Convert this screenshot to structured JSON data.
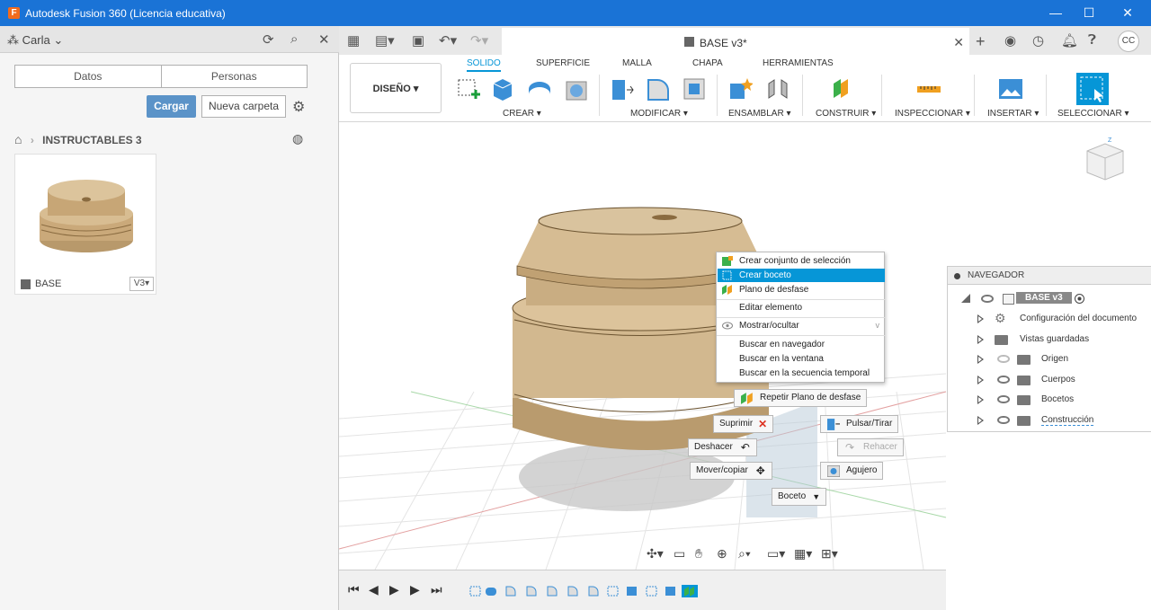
{
  "window": {
    "title": "Autodesk Fusion 360 (Licencia educativa)",
    "minimize": "—",
    "maximize": "☐",
    "close": "✕"
  },
  "left_panel": {
    "user": "Carla",
    "tabs": [
      "Datos",
      "Personas"
    ],
    "upload_label": "Cargar",
    "new_folder_label": "Nueva carpeta",
    "breadcrumb": "INSTRUCTABLES 3",
    "card": {
      "name": "BASE",
      "version": "V3▾"
    }
  },
  "doc_tab": {
    "title": "BASE v3*",
    "close": "✕"
  },
  "user_initials": "CC",
  "ribbon": {
    "workspace": "DISEÑO ▾",
    "tabs": [
      "SOLIDO",
      "SUPERFICIE",
      "MALLA",
      "CHAPA",
      "HERRAMIENTAS"
    ],
    "groups": [
      "CREAR ▾",
      "MODIFICAR ▾",
      "ENSAMBLAR ▾",
      "CONSTRUIR ▾",
      "INSPECCIONAR ▾",
      "INSERTAR ▾",
      "SELECCIONAR ▾"
    ]
  },
  "context_menu": {
    "items": [
      "Crear conjunto de selección",
      "Crear boceto",
      "Plano de desfase",
      "Editar elemento",
      "Mostrar/ocultar",
      "Buscar en navegador",
      "Buscar en la ventana",
      "Buscar en la secuencia temporal"
    ],
    "submenu_chevron": "v"
  },
  "marking_menu": {
    "repeat": "Repetir Plano de desfase",
    "delete": "Suprimir",
    "press_pull": "Pulsar/Tirar",
    "undo": "Deshacer",
    "redo": "Rehacer",
    "move_copy": "Mover/copiar",
    "hole": "Agujero",
    "sketch": "Boceto"
  },
  "navigator": {
    "title": "NAVEGADOR",
    "root": "BASE v3",
    "items": [
      "Configuración del documento",
      "Vistas guardadas",
      "Origen",
      "Cuerpos",
      "Bocetos",
      "Construcción"
    ]
  },
  "colors": {
    "titlebar": "#1a73d6",
    "accent": "#0696d7",
    "model": "#d2b88f"
  }
}
